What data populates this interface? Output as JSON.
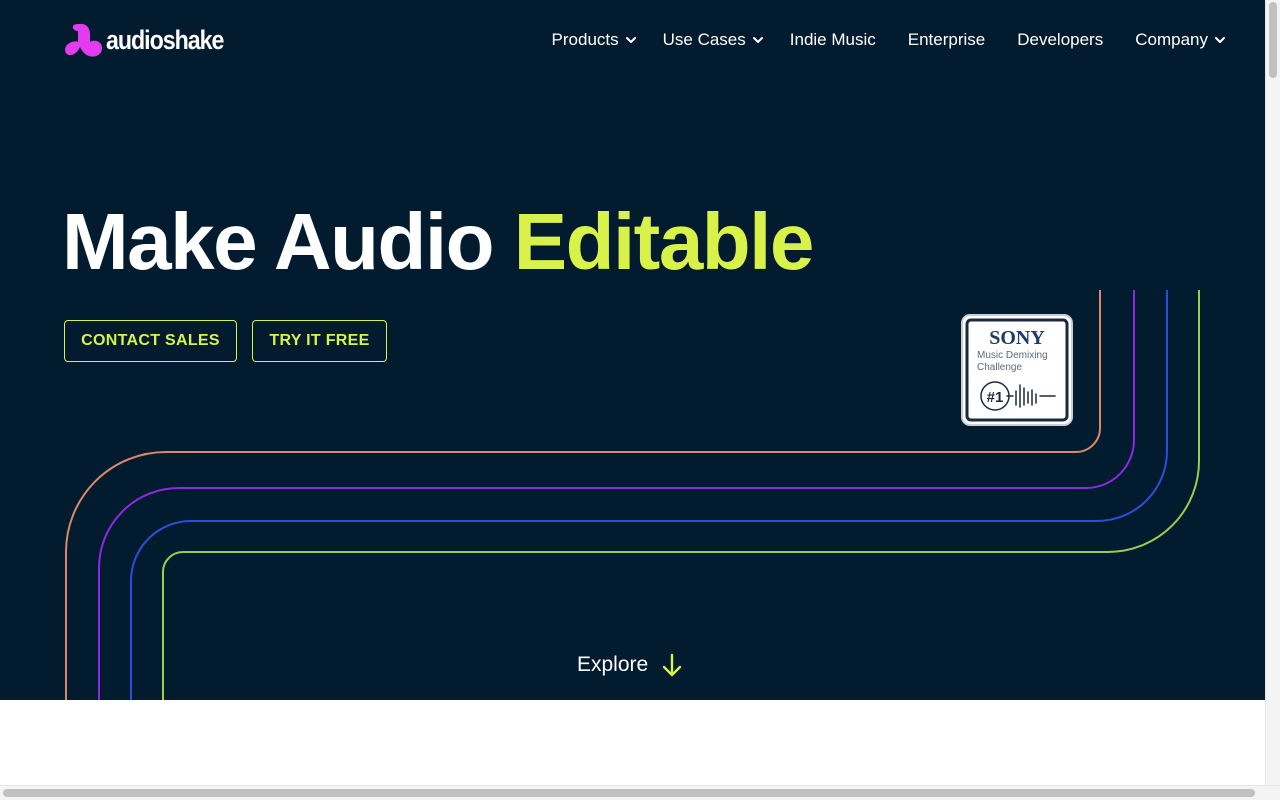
{
  "brand": {
    "name": "audioshake",
    "logo_color": "#e23bf0"
  },
  "nav": {
    "items": [
      {
        "label": "Products",
        "has_dropdown": true
      },
      {
        "label": "Use Cases",
        "has_dropdown": true
      },
      {
        "label": "Indie Music",
        "has_dropdown": false
      },
      {
        "label": "Enterprise",
        "has_dropdown": false
      },
      {
        "label": "Developers",
        "has_dropdown": false
      },
      {
        "label": "Company",
        "has_dropdown": true
      }
    ],
    "dropdown_icon": "chevron-down-icon"
  },
  "hero": {
    "headline_main": "Make Audio",
    "headline_accent": "Editable",
    "accent_color": "#d8f24a",
    "background_color": "#021b2f",
    "contact_button": "CONTACT SALES",
    "try_button": "TRY IT FREE",
    "explore_label": "Explore",
    "explore_icon": "arrow-down-icon"
  },
  "badge": {
    "brand": "SONY",
    "line1": "Music Demixing",
    "line2": "Challenge",
    "rank": "#1"
  },
  "decor": {
    "line_colors": [
      "#d98a6a",
      "#8a2be2",
      "#2c4fd9",
      "#9ccc4e"
    ]
  }
}
